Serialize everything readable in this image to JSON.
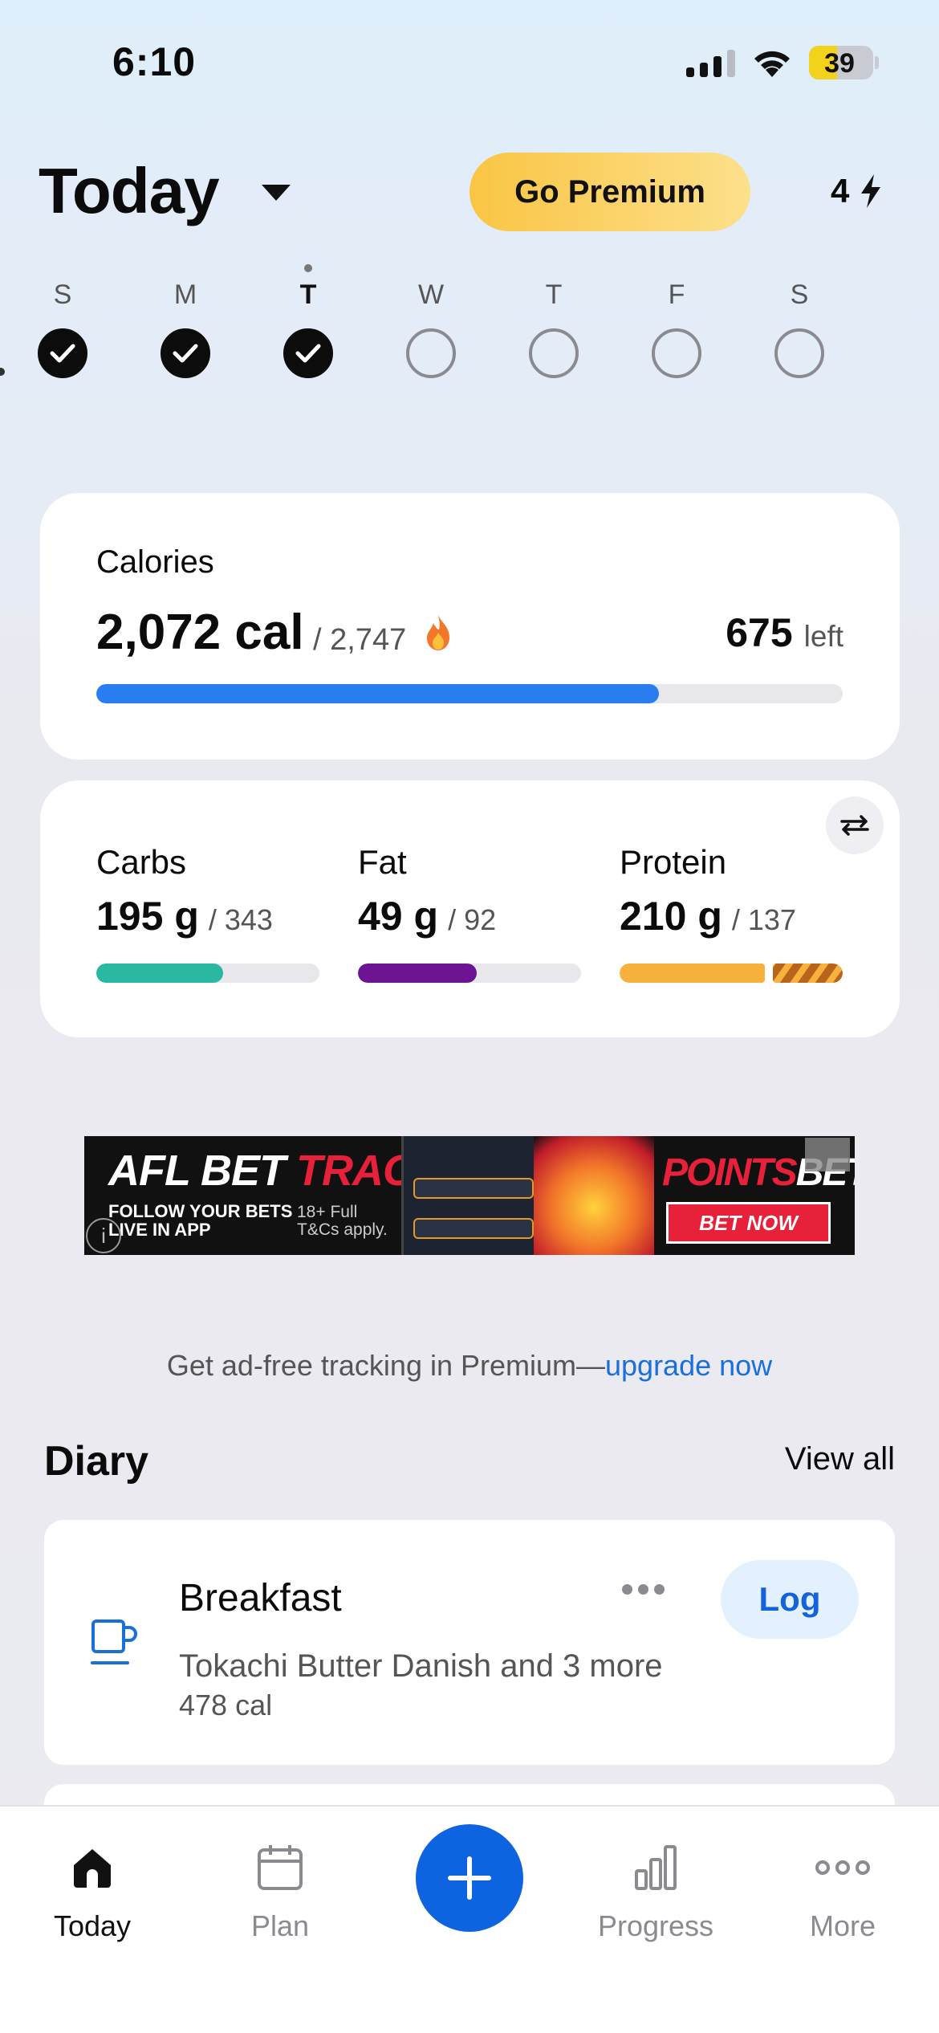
{
  "status_bar": {
    "time": "6:10",
    "battery": "39"
  },
  "header": {
    "title": "Today",
    "premium_label": "Go Premium",
    "streak_count": "4"
  },
  "week": [
    {
      "label": "S",
      "done": true,
      "current": false
    },
    {
      "label": "M",
      "done": true,
      "current": false
    },
    {
      "label": "T",
      "done": true,
      "current": true
    },
    {
      "label": "W",
      "done": false,
      "current": false
    },
    {
      "label": "T",
      "done": false,
      "current": false
    },
    {
      "label": "F",
      "done": false,
      "current": false
    },
    {
      "label": "S",
      "done": false,
      "current": false
    }
  ],
  "calories": {
    "label": "Calories",
    "value": "2,072 cal",
    "goal": "/ 2,747",
    "left_value": "675",
    "left_word": "left",
    "progress": 0.754,
    "color": "#2a7df0"
  },
  "macros": [
    {
      "name": "Carbs",
      "value": "195 g",
      "goal": "/ 343",
      "progress": 0.568,
      "color": "#2bb8a3",
      "over": false
    },
    {
      "name": "Fat",
      "value": "49 g",
      "goal": "/ 92",
      "progress": 0.533,
      "color": "#6c1491",
      "over": false
    },
    {
      "name": "Protein",
      "value": "210 g",
      "goal": "/ 137",
      "progress": 1.0,
      "color": "#f7b13d",
      "over": true,
      "over_fraction": 0.348
    }
  ],
  "ad": {
    "title_white": "AFL BET ",
    "title_red": "TRACKER",
    "sub": "FOLLOW YOUR BETS\nLIVE IN APP",
    "note": "18+ Full\nT&Cs apply.",
    "brand_red": "POINTS",
    "brand_white": "BET",
    "cta": "BET NOW"
  },
  "upsell": {
    "text": "Get ad-free tracking in Premium—",
    "link": "upgrade now"
  },
  "diary": {
    "title": "Diary",
    "view_all": "View all",
    "meals": [
      {
        "name": "Breakfast",
        "log_label": "Log",
        "description": "Tokachi Butter Danish and 3 more",
        "calories": "478 cal"
      }
    ]
  },
  "tabs": [
    {
      "label": "Today",
      "icon": "home-icon",
      "active": true
    },
    {
      "label": "Plan",
      "icon": "calendar-icon",
      "active": false
    },
    {
      "label": "Progress",
      "icon": "bar-chart-icon",
      "active": false
    },
    {
      "label": "More",
      "icon": "more-dots-icon",
      "active": false
    }
  ]
}
